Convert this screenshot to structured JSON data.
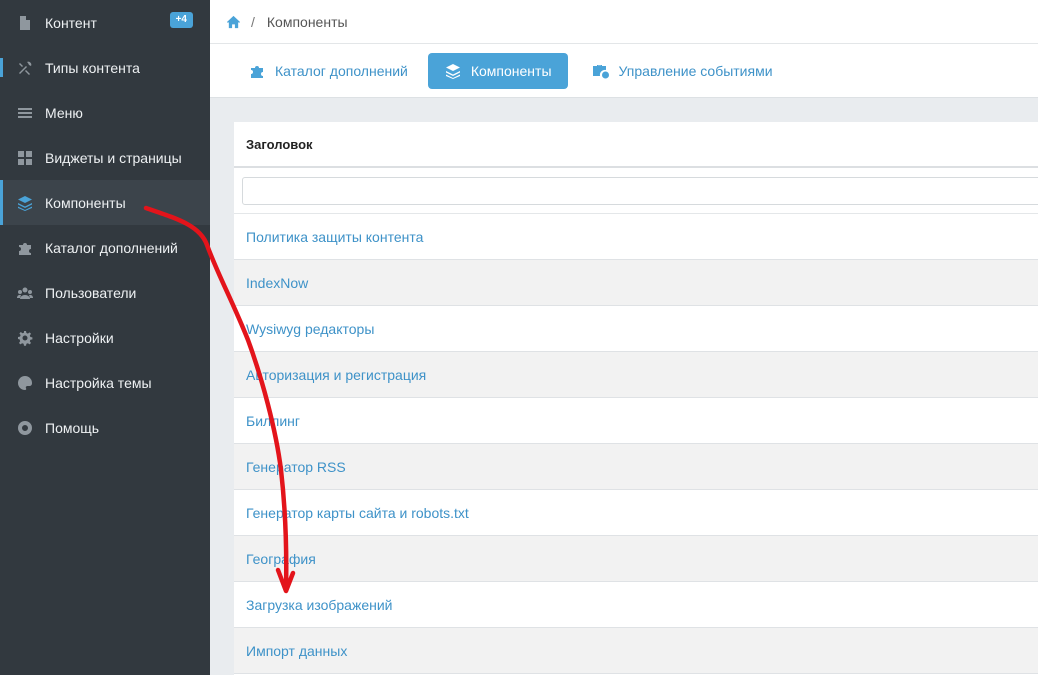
{
  "sidebar": {
    "items": [
      {
        "label": "Контент",
        "icon": "document-icon",
        "badge": "+4"
      },
      {
        "label": "Типы контента",
        "icon": "tools-icon"
      },
      {
        "label": "Меню",
        "icon": "menu-icon"
      },
      {
        "label": "Виджеты и страницы",
        "icon": "widgets-icon"
      },
      {
        "label": "Компоненты",
        "icon": "layers-icon",
        "active": true
      },
      {
        "label": "Каталог дополнений",
        "icon": "puzzle-icon"
      },
      {
        "label": "Пользователи",
        "icon": "users-icon"
      },
      {
        "label": "Настройки",
        "icon": "gear-icon"
      },
      {
        "label": "Настройка темы",
        "icon": "palette-icon"
      },
      {
        "label": "Помощь",
        "icon": "lifebuoy-icon"
      }
    ]
  },
  "breadcrumb": {
    "separator": "/",
    "current": "Компоненты"
  },
  "tabs": [
    {
      "label": "Каталог дополнений",
      "icon": "puzzle-icon"
    },
    {
      "label": "Компоненты",
      "icon": "layers-icon",
      "active": true
    },
    {
      "label": "Управление событиями",
      "icon": "briefcase-clock-icon"
    }
  ],
  "table": {
    "header": "Заголовок",
    "filter_value": "",
    "rows": [
      "Политика защиты контента",
      "IndexNow",
      "Wysiwyg редакторы",
      "Авторизация и регистрация",
      "Биллинг",
      "Генератор RSS",
      "Генератор карты сайта и robots.txt",
      "География",
      "Загрузка изображений",
      "Импорт данных"
    ]
  },
  "colors": {
    "accent": "#4aa3d8",
    "sidebar_bg": "#32393f",
    "link": "#3e92c8",
    "annotation": "#e3141b"
  }
}
